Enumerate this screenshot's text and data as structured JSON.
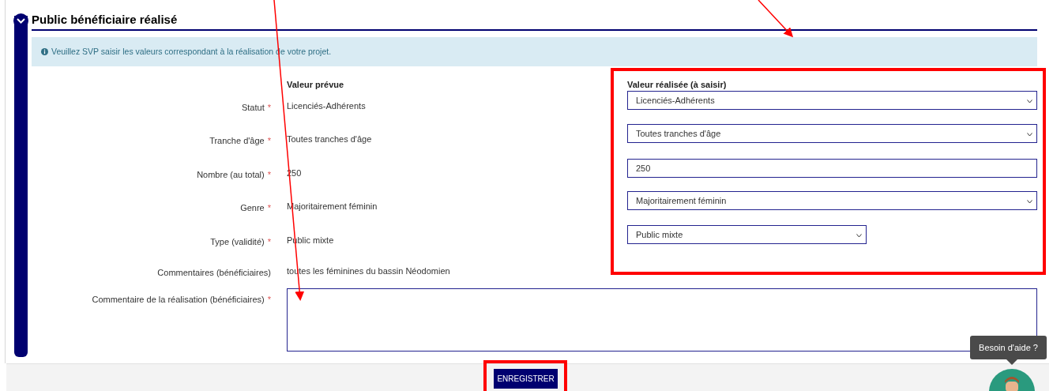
{
  "section": {
    "title": "Public bénéficiaire réalisé",
    "expanded": true,
    "info": "Veuillez SVP saisir les valeurs correspondant à la réalisation de votre projet.",
    "planned_header": "Valeur prévue",
    "realised_header": "Valeur réalisée (à saisir)",
    "rows": [
      {
        "label": "Statut",
        "required_mark": "*",
        "planned": "Licenciés-Adhérents",
        "kind": "select",
        "value": "Licenciés-Adhérents",
        "wide": true
      },
      {
        "label": "Tranche d'âge",
        "required_mark": "*",
        "planned": "Toutes tranches d'âge",
        "kind": "select",
        "value": "Toutes tranches d'âge",
        "wide": true
      },
      {
        "label": "Nombre (au total)",
        "required_mark": "*",
        "planned": "250",
        "kind": "input",
        "value": "250",
        "wide": true
      },
      {
        "label": "Genre",
        "required_mark": "*",
        "planned": "Majoritairement féminin",
        "kind": "select",
        "value": "Majoritairement féminin",
        "wide": true
      },
      {
        "label": "Type (validité)",
        "required_mark": "*",
        "planned": "Public mixte",
        "kind": "select",
        "value": "Public mixte",
        "wide": false
      },
      {
        "label": "Commentaires (bénéficiaires)",
        "planned": "toutes les féminines du bassin Néodomien",
        "kind": "none"
      }
    ],
    "comment": {
      "label": "Commentaire de la réalisation (bénéficiaires)",
      "required_mark": "*"
    }
  },
  "save_button": "ENREGISTRER",
  "help": {
    "tooltip": "Besoin d'aide ?"
  }
}
